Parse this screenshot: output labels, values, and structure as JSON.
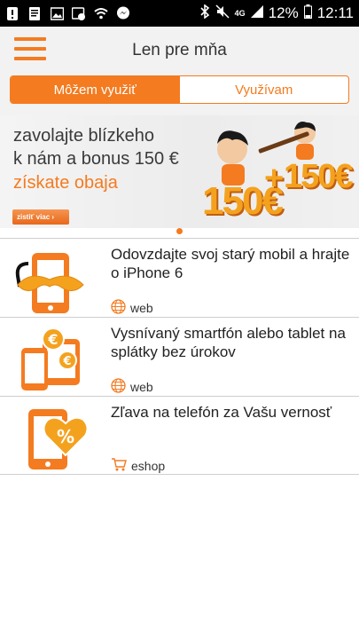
{
  "status_bar": {
    "battery_percent": "12%",
    "time": "12:11",
    "network": "4G"
  },
  "app_bar": {
    "title": "Len pre mňa"
  },
  "tabs": [
    {
      "label": "Môžem využiť",
      "active": true
    },
    {
      "label": "Využívam",
      "active": false
    }
  ],
  "banner": {
    "line1": "zavolajte blízkeho",
    "line2": "k nám a bonus 150 €",
    "line3": "získate obaja",
    "button_label": "zistiť viac ›",
    "amount_left": "150€",
    "amount_right": "150€"
  },
  "offers": [
    {
      "title": "Odovzdajte svoj starý mobil a hrajte o iPhone 6",
      "source": "web",
      "source_icon": "globe-icon"
    },
    {
      "title": "Vysnívaný smartfón alebo tablet na splátky bez úrokov",
      "source": "web",
      "source_icon": "globe-icon"
    },
    {
      "title": "Zľava na telefón za Vašu vernosť",
      "source": "eshop",
      "source_icon": "cart-icon"
    }
  ],
  "colors": {
    "accent": "#f47b20",
    "status_bar": "#000000",
    "app_bar": "#f2f2f2"
  }
}
